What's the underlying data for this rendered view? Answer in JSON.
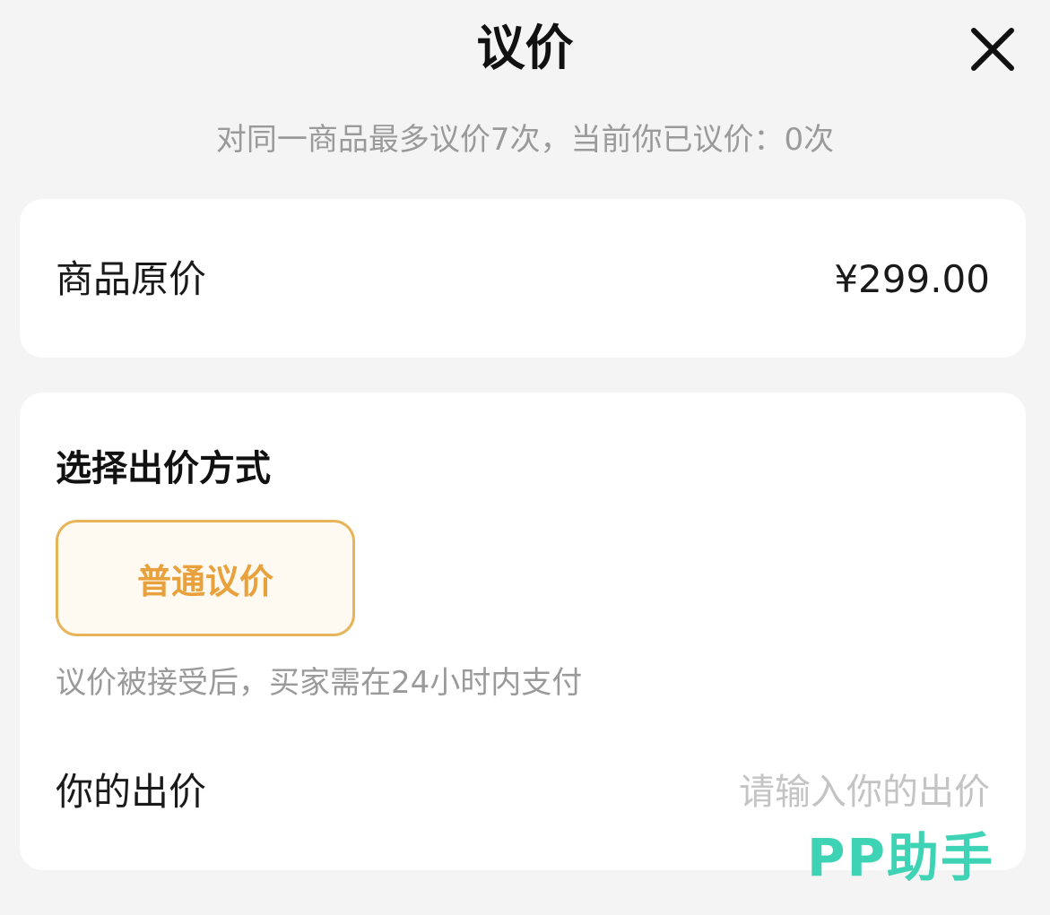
{
  "header": {
    "title": "议价",
    "close_icon": "close-icon"
  },
  "subtitle": "对同一商品最多议价7次，当前你已议价：0次",
  "price_card": {
    "label": "商品原价",
    "value": "¥299.00"
  },
  "offer_card": {
    "section_title": "选择出价方式",
    "mode_button": "普通议价",
    "mode_note": "议价被接受后，买家需在24小时内支付",
    "offer_label": "你的出价",
    "offer_placeholder": "请输入你的出价"
  },
  "watermark": "PP助手",
  "colors": {
    "background": "#f4f4f4",
    "card": "#ffffff",
    "accent": "#e8a13c",
    "accent_border": "#e7b45a",
    "accent_bg": "#fffaf1",
    "muted_text": "#9a9a9a",
    "placeholder_text": "#c4c4c4",
    "watermark": "#3fd3b6"
  }
}
